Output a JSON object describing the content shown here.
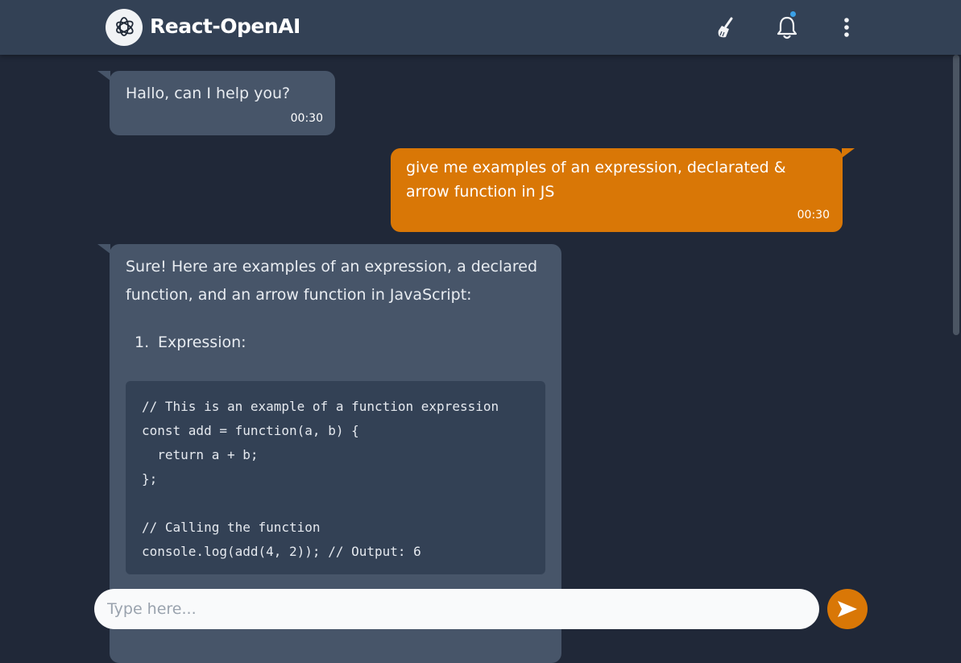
{
  "header": {
    "app_title": "React-OpenAI",
    "logo_icon": "openai-logo-icon",
    "clear_icon": "broom-icon",
    "notification_icon": "bell-icon",
    "menu_icon": "vertical-dots-icon",
    "notification_dot_color": "#3ba0e6"
  },
  "messages": [
    {
      "role": "bot",
      "text": "Hallo, can I help you?",
      "time": "00:30"
    },
    {
      "role": "user",
      "text": "give me examples of an expression, declarated & arrow function in JS",
      "time": "00:30"
    },
    {
      "role": "bot",
      "intro": "Sure! Here are examples of an expression, a declared function, and an arrow function in JavaScript:",
      "list_number": "1.",
      "list_item": "Expression:",
      "code_lines": [
        "// This is an example of a function expression",
        "const add = function(a, b) {",
        "  return a + b;",
        "};",
        "",
        "// Calling the function",
        "console.log(add(4, 2)); // Output: 6"
      ]
    }
  ],
  "composer": {
    "placeholder": "Type here...",
    "value": "",
    "send_icon": "send-arrow-icon"
  },
  "colors": {
    "background": "#202838",
    "header": "#334155",
    "bot_bubble": "#475569",
    "user_bubble": "#d97706",
    "code_block": "#334155",
    "accent": "#d97706"
  }
}
